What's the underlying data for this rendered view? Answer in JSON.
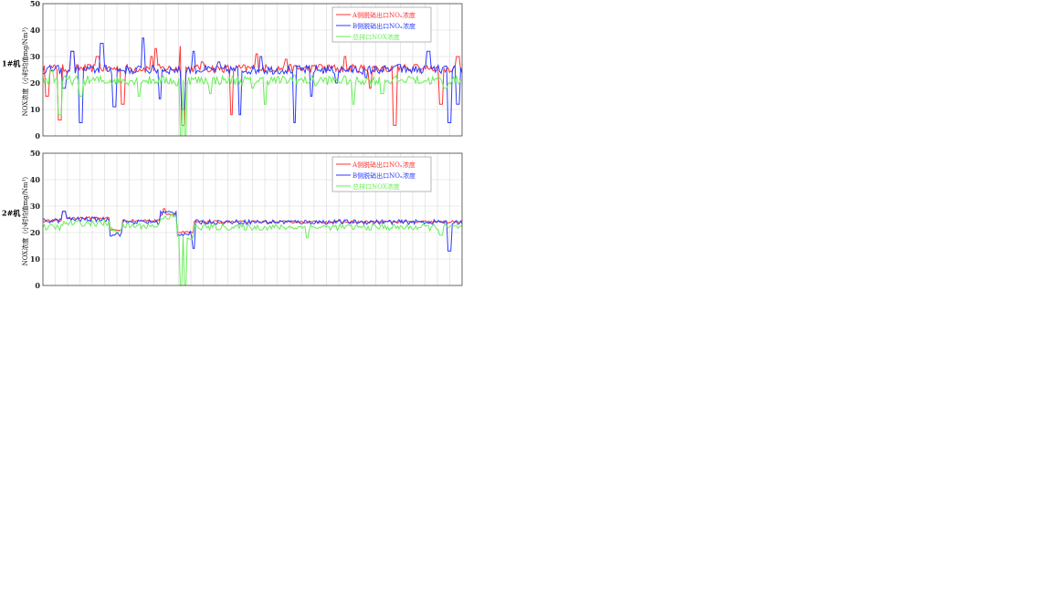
{
  "chart_data": [
    {
      "type": "line",
      "unit_label": "1#机",
      "ylabel": "NOX浓度（小时均值mg/Nm³）",
      "ylim": [
        0,
        50
      ],
      "yticks": [
        0,
        10,
        20,
        30,
        40,
        50
      ],
      "grid": true,
      "legend_position": "top-right",
      "series": [
        {
          "name": "A侧脱硝出口NOₓ浓度",
          "color": "#ff3333",
          "baseline": 25.5,
          "noise": 1.6,
          "events": [
            [
              0.01,
              15
            ],
            [
              0.04,
              6
            ],
            [
              0.07,
              32
            ],
            [
              0.13,
              30
            ],
            [
              0.19,
              12
            ],
            [
              0.26,
              30
            ],
            [
              0.27,
              33
            ],
            [
              0.33,
              34
            ],
            [
              0.335,
              4
            ],
            [
              0.38,
              28
            ],
            [
              0.45,
              8
            ],
            [
              0.51,
              31
            ],
            [
              0.58,
              29
            ],
            [
              0.66,
              27
            ],
            [
              0.72,
              30
            ],
            [
              0.78,
              18
            ],
            [
              0.84,
              4
            ],
            [
              0.89,
              27
            ],
            [
              0.95,
              12
            ],
            [
              0.99,
              30
            ]
          ]
        },
        {
          "name": "B侧脱硝出口NOₓ浓度",
          "color": "#2a3bff",
          "baseline": 25,
          "noise": 1.7,
          "events": [
            [
              0.05,
              18
            ],
            [
              0.07,
              32
            ],
            [
              0.09,
              5
            ],
            [
              0.14,
              35
            ],
            [
              0.17,
              11
            ],
            [
              0.22,
              24
            ],
            [
              0.24,
              37
            ],
            [
              0.28,
              14
            ],
            [
              0.31,
              25
            ],
            [
              0.335,
              10
            ],
            [
              0.36,
              32
            ],
            [
              0.42,
              28
            ],
            [
              0.47,
              8
            ],
            [
              0.52,
              30
            ],
            [
              0.6,
              5
            ],
            [
              0.64,
              15
            ],
            [
              0.7,
              20
            ],
            [
              0.77,
              22
            ],
            [
              0.85,
              27
            ],
            [
              0.92,
              32
            ],
            [
              0.97,
              5
            ],
            [
              0.99,
              12
            ]
          ]
        },
        {
          "name": "总排口NOX浓度",
          "color": "#66ee55",
          "baseline": 21,
          "noise": 1.8,
          "events": [
            [
              0.02,
              25
            ],
            [
              0.04,
              8
            ],
            [
              0.09,
              15
            ],
            [
              0.15,
              20
            ],
            [
              0.23,
              15
            ],
            [
              0.32,
              19
            ],
            [
              0.33,
              0
            ],
            [
              0.34,
              0
            ],
            [
              0.4,
              16
            ],
            [
              0.5,
              18
            ],
            [
              0.53,
              12
            ],
            [
              0.6,
              23
            ],
            [
              0.65,
              19
            ],
            [
              0.74,
              12
            ],
            [
              0.81,
              16
            ],
            [
              0.88,
              22
            ],
            [
              0.96,
              18
            ]
          ]
        }
      ]
    },
    {
      "type": "line",
      "unit_label": "2#机",
      "ylabel": "NOX浓度（小时均值mg/Nm³）",
      "ylim": [
        0,
        50
      ],
      "yticks": [
        0,
        10,
        20,
        30,
        40,
        50
      ],
      "grid": true,
      "legend_position": "top-right",
      "series": [
        {
          "name": "A侧脱硝出口NOₓ浓度",
          "color": "#ff3333",
          "segments": [
            [
              0.0,
              0.05,
              24.5
            ],
            [
              0.05,
              0.16,
              25.5
            ],
            [
              0.16,
              0.19,
              21
            ],
            [
              0.19,
              0.28,
              24.5
            ],
            [
              0.28,
              0.32,
              27
            ],
            [
              0.32,
              0.36,
              20
            ],
            [
              0.36,
              1.0,
              24
            ]
          ],
          "noise": 0.5,
          "events": [
            [
              0.05,
              28
            ],
            [
              0.29,
              29
            ]
          ]
        },
        {
          "name": "B侧脱硝出口NOₓ浓度",
          "color": "#2a3bff",
          "segments": [
            [
              0.0,
              0.05,
              24.5
            ],
            [
              0.05,
              0.16,
              25
            ],
            [
              0.16,
              0.19,
              19.5
            ],
            [
              0.19,
              0.28,
              24
            ],
            [
              0.28,
              0.32,
              27.5
            ],
            [
              0.32,
              0.36,
              19.5
            ],
            [
              0.36,
              1.0,
              24
            ]
          ],
          "noise": 0.9,
          "events": [
            [
              0.05,
              28
            ],
            [
              0.36,
              14
            ],
            [
              0.97,
              13
            ]
          ]
        },
        {
          "name": "总排口NOX浓度",
          "color": "#66ee55",
          "segments": [
            [
              0.0,
              0.05,
              22
            ],
            [
              0.05,
              0.16,
              23.5
            ],
            [
              0.16,
              0.19,
              21
            ],
            [
              0.19,
              0.28,
              22.5
            ],
            [
              0.28,
              0.32,
              26
            ],
            [
              0.32,
              0.36,
              18
            ],
            [
              0.36,
              1.0,
              22
            ]
          ],
          "noise": 1.2,
          "events": [
            [
              0.33,
              0
            ],
            [
              0.34,
              0
            ],
            [
              0.63,
              18
            ],
            [
              0.95,
              19
            ]
          ]
        }
      ]
    }
  ]
}
